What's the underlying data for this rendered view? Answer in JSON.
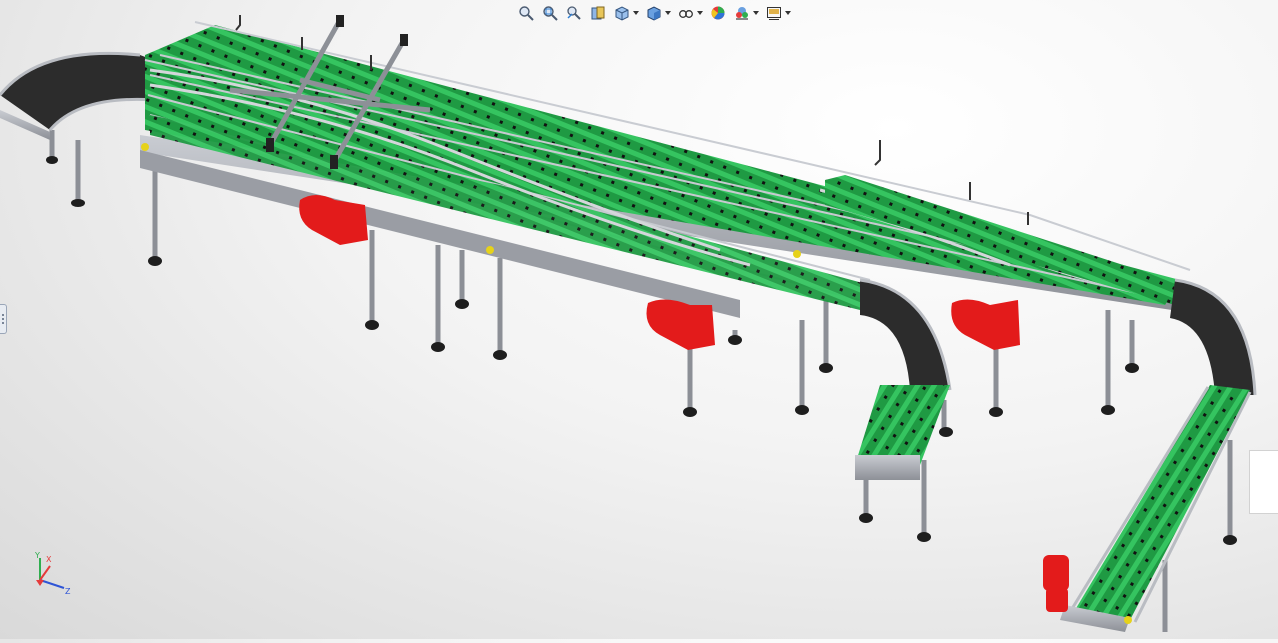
{
  "window": {
    "title": ""
  },
  "view_toolbar": {
    "buttons": [
      {
        "id": "zoom-to-fit",
        "icon": "zoom-to-fit-icon"
      },
      {
        "id": "zoom-to-area",
        "icon": "zoom-to-area-icon"
      },
      {
        "id": "previous-view",
        "icon": "previous-view-icon"
      },
      {
        "id": "section-view",
        "icon": "section-view-icon"
      },
      {
        "id": "view-orientation",
        "icon": "view-orientation-icon",
        "dropdown": true
      },
      {
        "id": "display-style",
        "icon": "display-style-icon",
        "dropdown": true
      },
      {
        "id": "hide-show-items",
        "icon": "hide-show-items-icon",
        "dropdown": true
      },
      {
        "id": "edit-appearance",
        "icon": "edit-appearance-icon"
      },
      {
        "id": "apply-scene",
        "icon": "apply-scene-icon",
        "dropdown": true
      },
      {
        "id": "view-settings",
        "icon": "view-settings-icon",
        "dropdown": true
      }
    ]
  },
  "triad": {
    "x_label": "X",
    "y_label": "Y",
    "z_label": "Z"
  },
  "colors": {
    "belt_green": "#22a84a",
    "belt_dark": "#2b2b2b",
    "frame_gray": "#9ea1a8",
    "motor_red": "#e31b1b",
    "sensor_yellow": "#e6d21a"
  },
  "model": {
    "description_visible": false
  }
}
